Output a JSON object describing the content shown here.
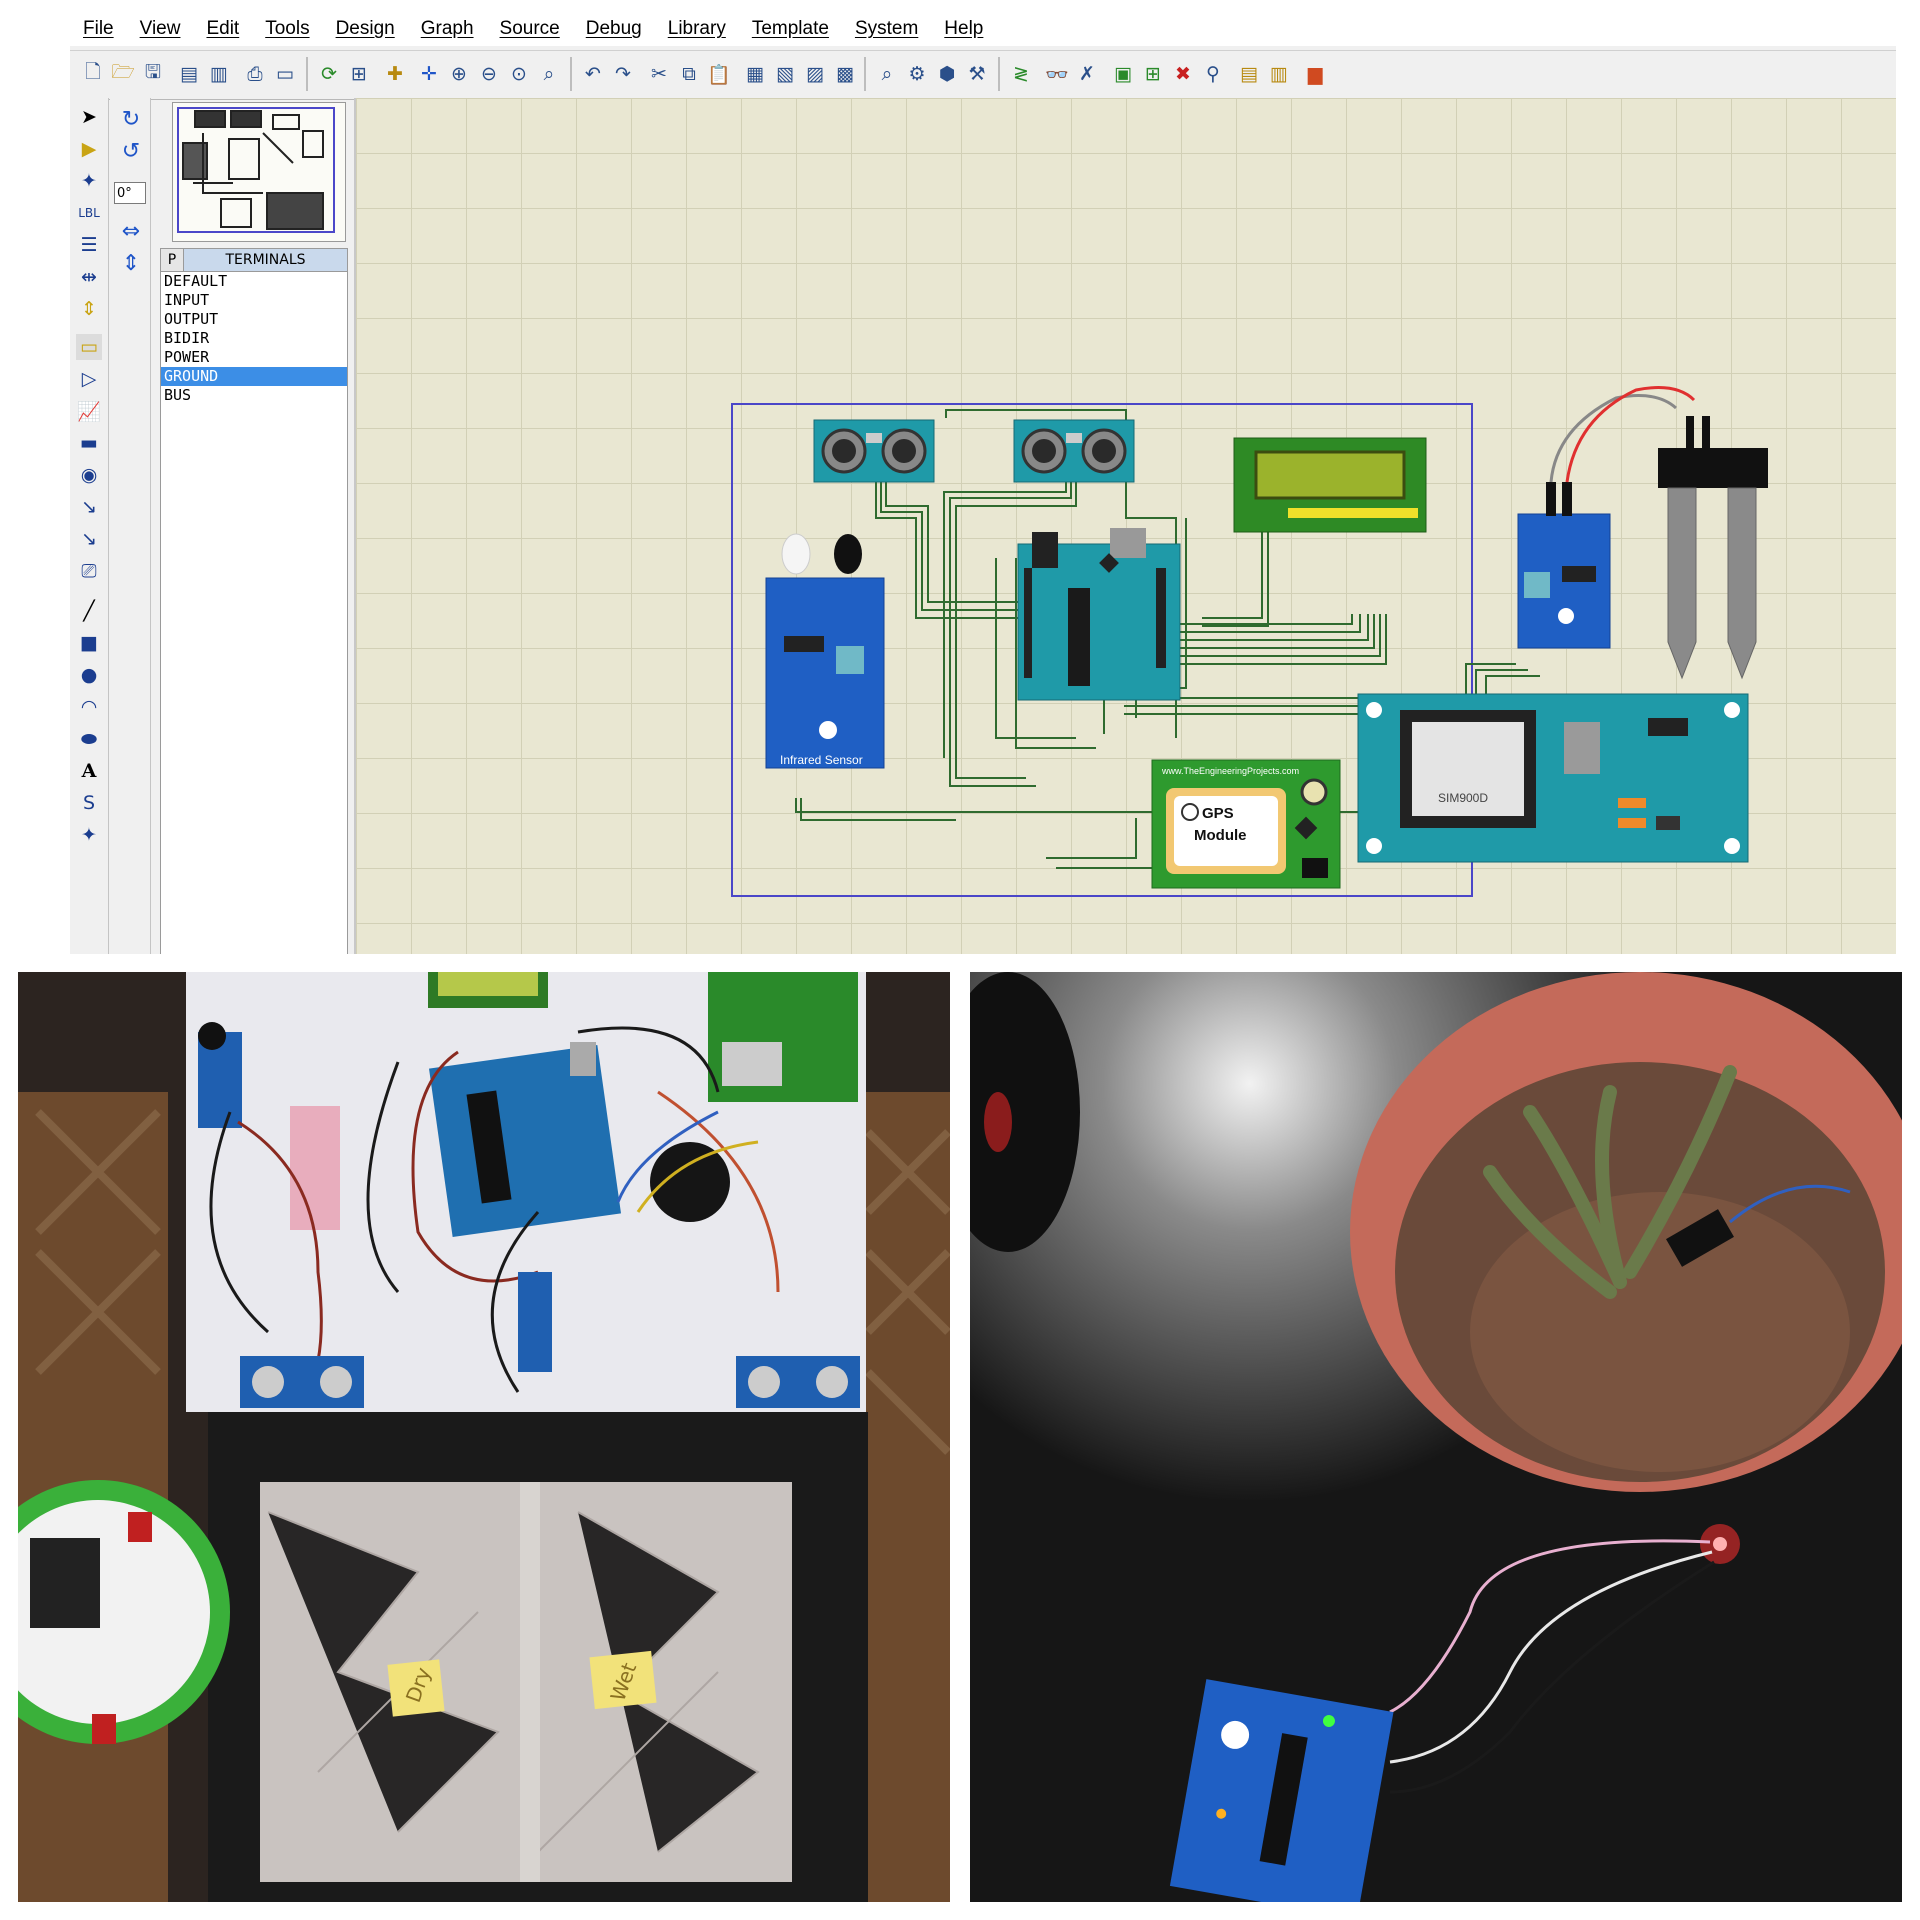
{
  "menu": [
    "File",
    "View",
    "Edit",
    "Tools",
    "Design",
    "Graph",
    "Source",
    "Debug",
    "Library",
    "Template",
    "System",
    "Help"
  ],
  "rotation_value": "0°",
  "picker": {
    "mode_letter": "P",
    "title": "TERMINALS",
    "items": [
      "DEFAULT",
      "INPUT",
      "OUTPUT",
      "BIDIR",
      "POWER",
      "GROUND",
      "BUS"
    ],
    "selected": "GROUND"
  },
  "schematic": {
    "ir_sensor_label": "Infrared Sensor",
    "gps_label_1": "GPS",
    "gps_label_2": "Module",
    "gsm_chip_label": "SIM900D",
    "site_label": "www.TheEngineeringProjects.com"
  },
  "photo_left": {
    "label_dry": "Dry",
    "label_wet": "Wet"
  },
  "colors": {
    "canvas": "#e9e7d2",
    "grid": "#d2d0b6",
    "selection": "#3c8ee6",
    "wire": "#2f6b2f",
    "module_blue": "#1f5fc4",
    "module_teal": "#1f9aa8"
  }
}
